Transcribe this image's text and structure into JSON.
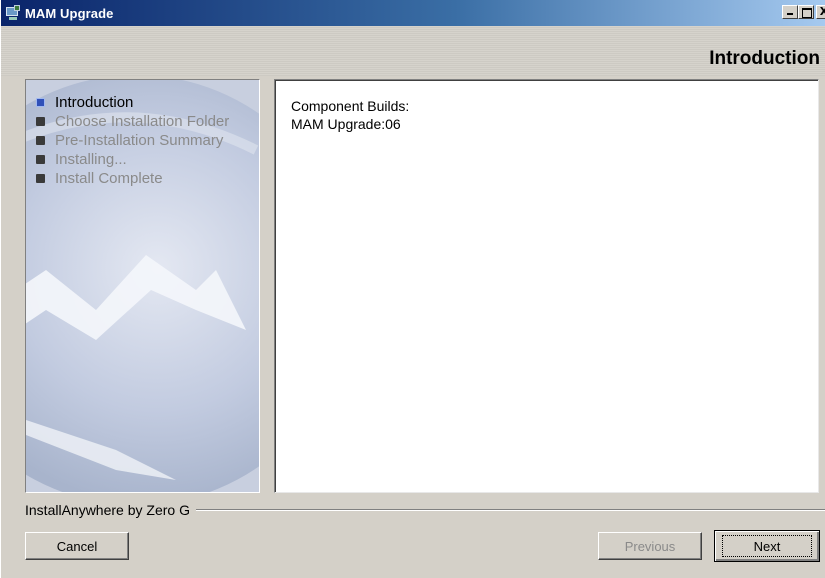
{
  "window": {
    "title": "MAM Upgrade",
    "controls": {
      "minimize": "_",
      "maximize": "□",
      "close": "X"
    }
  },
  "header": {
    "page_title": "Introduction"
  },
  "steps": [
    {
      "label": "Introduction",
      "active": true
    },
    {
      "label": "Choose Installation Folder",
      "active": false
    },
    {
      "label": "Pre-Installation Summary",
      "active": false
    },
    {
      "label": "Installing...",
      "active": false
    },
    {
      "label": "Install Complete",
      "active": false
    }
  ],
  "content": {
    "line1": "Component Builds:",
    "line2": "MAM Upgrade:06"
  },
  "footer": {
    "brand": "InstallAnywhere by Zero G",
    "cancel_label": "Cancel",
    "previous_label": "Previous",
    "next_label": "Next"
  },
  "colors": {
    "titlebar_start": "#0a246a",
    "titlebar_end": "#a6caf0",
    "active_bullet": "#3050b8",
    "disabled_text": "#8a8a8a"
  }
}
